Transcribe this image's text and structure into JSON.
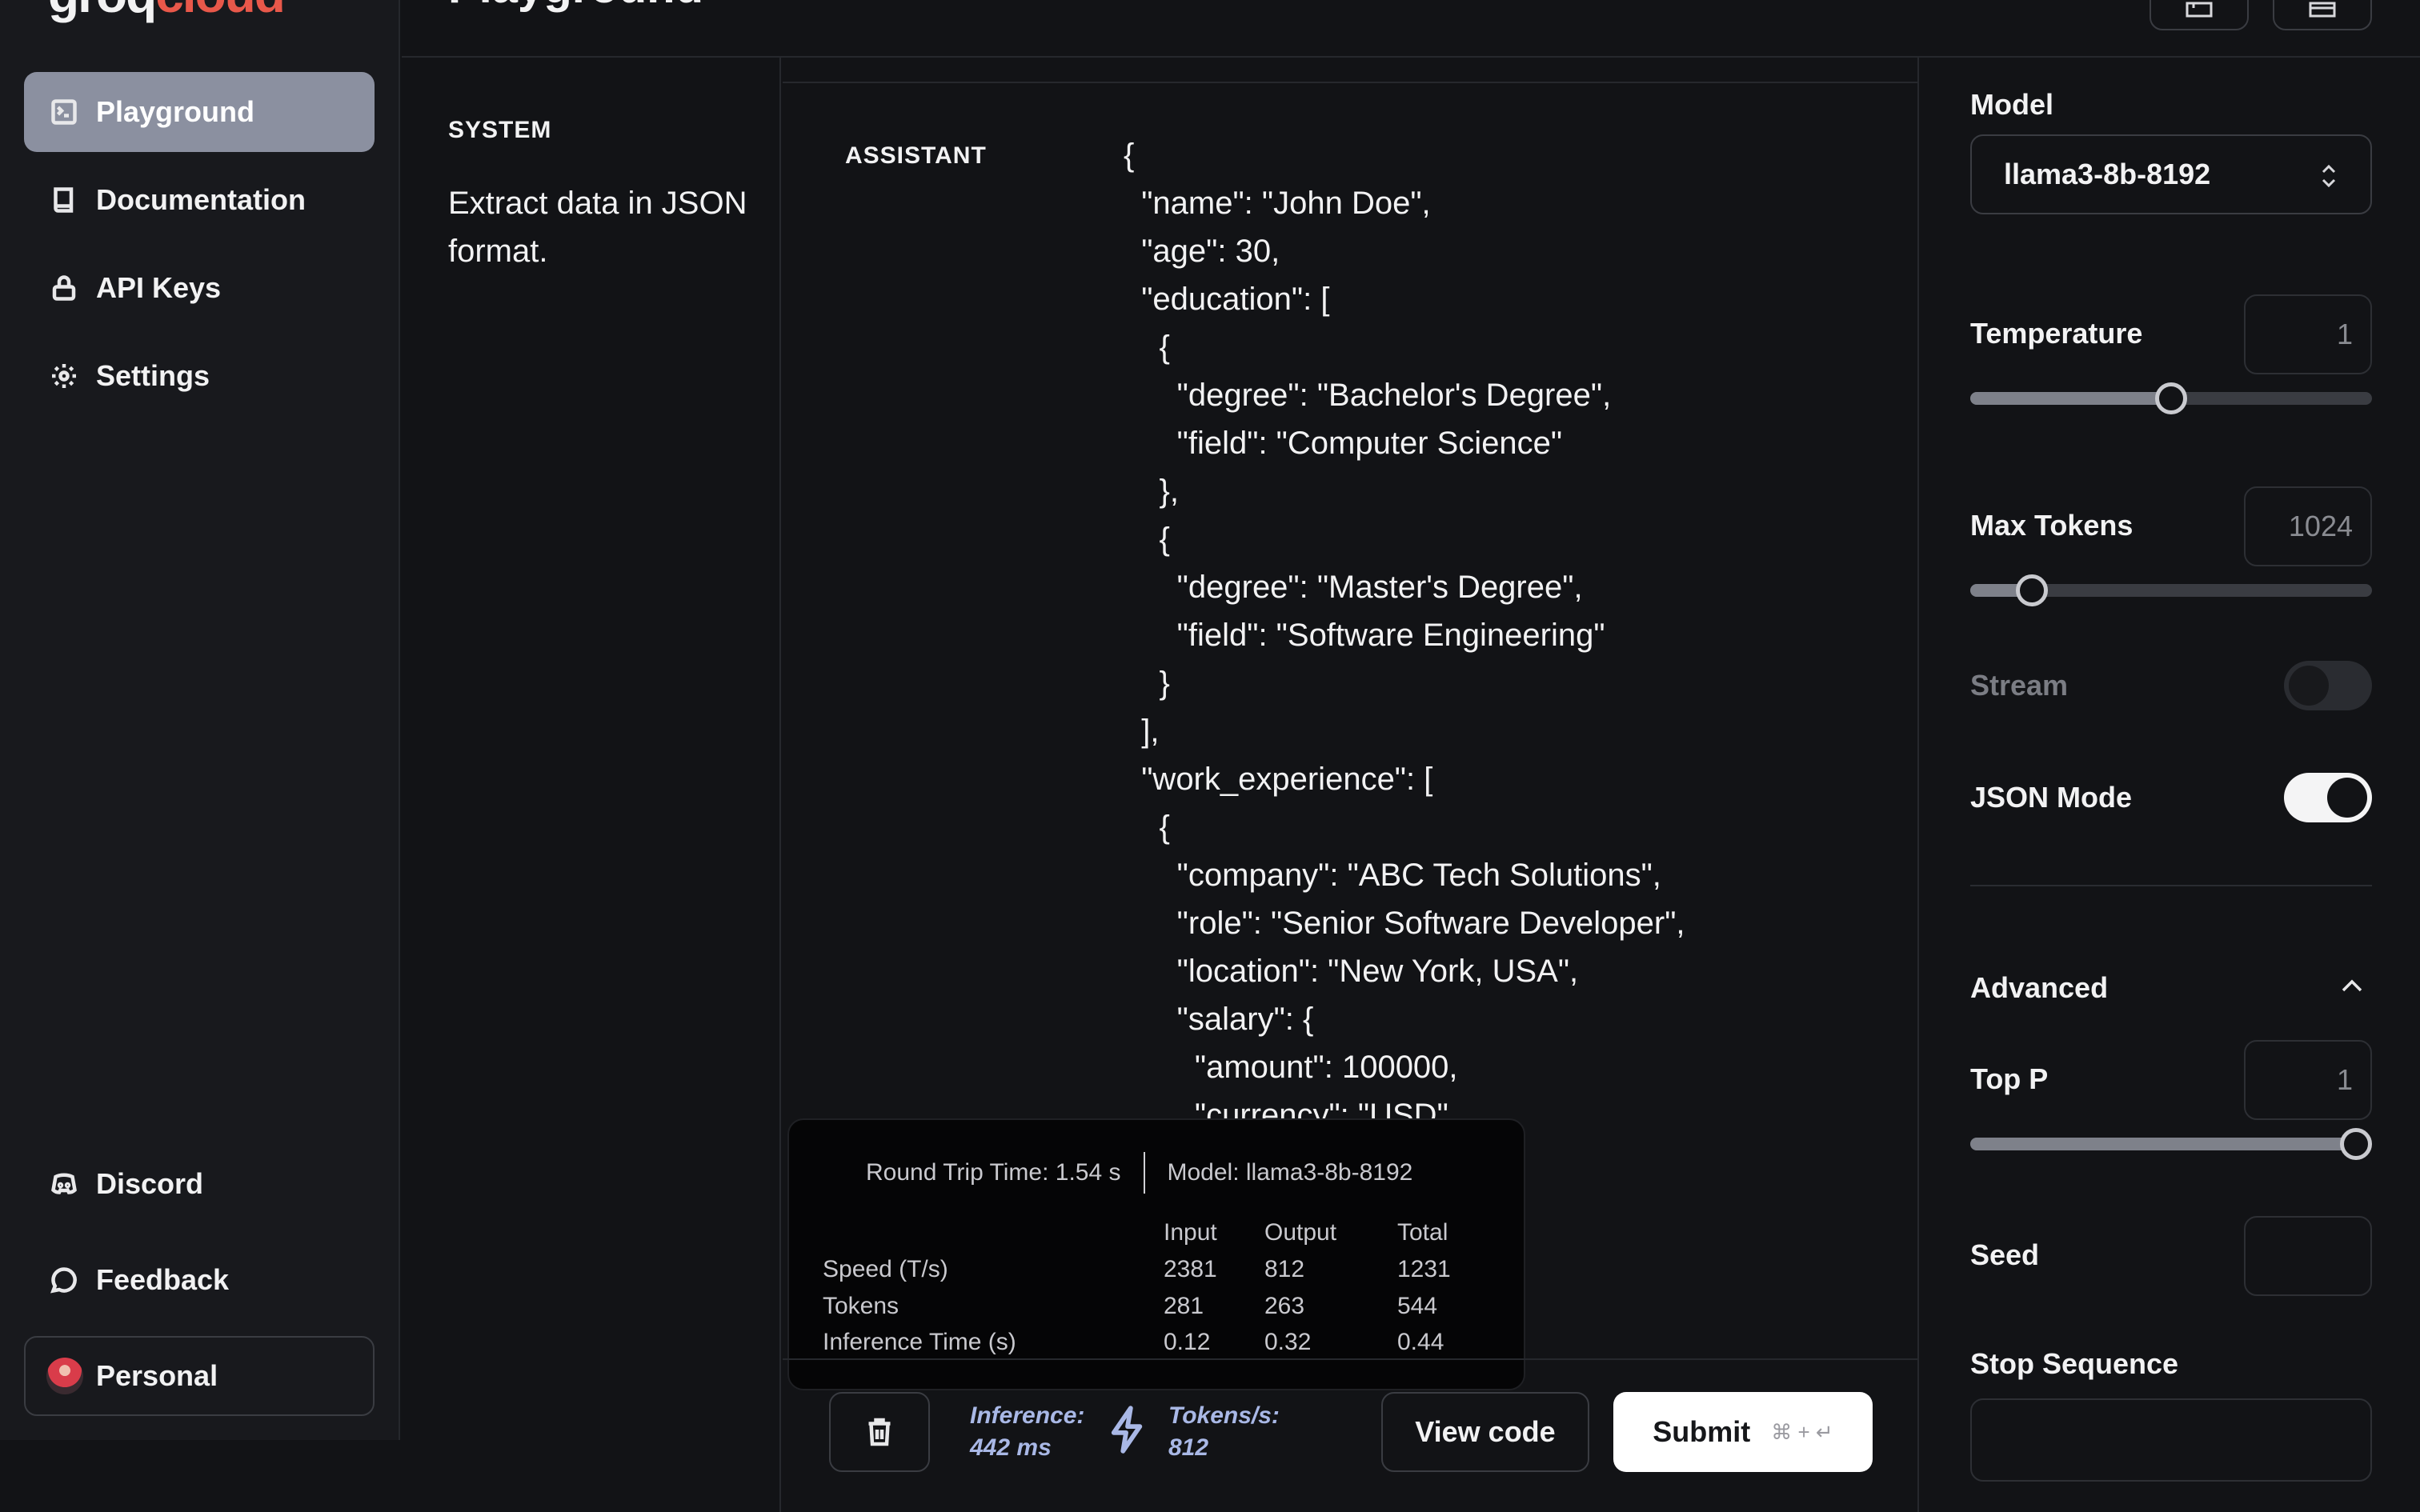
{
  "logo": {
    "part1": "groq",
    "part2": "cloud"
  },
  "nav": {
    "items": [
      {
        "label": "Playground",
        "active": true
      },
      {
        "label": "Documentation"
      },
      {
        "label": "API Keys"
      },
      {
        "label": "Settings"
      }
    ],
    "discord": "Discord",
    "feedback": "Feedback",
    "personal": "Personal"
  },
  "header": {
    "title": "Playground"
  },
  "system": {
    "label": "SYSTEM",
    "text": "Extract data in JSON format."
  },
  "assistant": {
    "label": "ASSISTANT",
    "content": "{\n  \"name\": \"John Doe\",\n  \"age\": 30,\n  \"education\": [\n    {\n      \"degree\": \"Bachelor's Degree\",\n      \"field\": \"Computer Science\"\n    },\n    {\n      \"degree\": \"Master's Degree\",\n      \"field\": \"Software Engineering\"\n    }\n  ],\n  \"work_experience\": [\n    {\n      \"company\": \"ABC Tech Solutions\",\n      \"role\": \"Senior Software Developer\",\n      \"location\": \"New York, USA\",\n      \"salary\": {\n        \"amount\": 100000,\n        \"currency\": \"USD\""
  },
  "stats": {
    "round_trip": "Round Trip Time: 1.54 s",
    "model": "Model: llama3-8b-8192",
    "columns": [
      "Input",
      "Output",
      "Total"
    ],
    "rows": [
      {
        "label": "Speed (T/s)",
        "input": "2381",
        "output": "812",
        "total": "1231"
      },
      {
        "label": "Tokens",
        "input": "281",
        "output": "263",
        "total": "544"
      },
      {
        "label": "Inference Time (s)",
        "input": "0.12",
        "output": "0.32",
        "total": "0.44"
      }
    ]
  },
  "footer": {
    "inference_label": "Inference:",
    "inference_value": "442 ms",
    "tokens_label": "Tokens/s:",
    "tokens_value": "812",
    "view_code": "View code",
    "submit": "Submit",
    "shortcut": "⌘ + ↵"
  },
  "settings": {
    "model_label": "Model",
    "model_value": "llama3-8b-8192",
    "temperature": {
      "label": "Temperature",
      "value": "1",
      "fraction": 0.5
    },
    "max_tokens": {
      "label": "Max Tokens",
      "value": "1024",
      "fraction": 0.154
    },
    "stream": {
      "label": "Stream",
      "on": false
    },
    "json_mode": {
      "label": "JSON Mode",
      "on": true
    },
    "advanced": "Advanced",
    "top_p": {
      "label": "Top P",
      "value": "1",
      "fraction": 0.96
    },
    "seed": {
      "label": "Seed",
      "value": ""
    },
    "stop_sequence": {
      "label": "Stop Sequence",
      "value": ""
    }
  },
  "colors": {
    "background": "#121316",
    "sidebar": "#18191d",
    "active_nav": "#8b90a0",
    "logo_accent": "#e8584a",
    "metric": "#a9b8e6"
  }
}
